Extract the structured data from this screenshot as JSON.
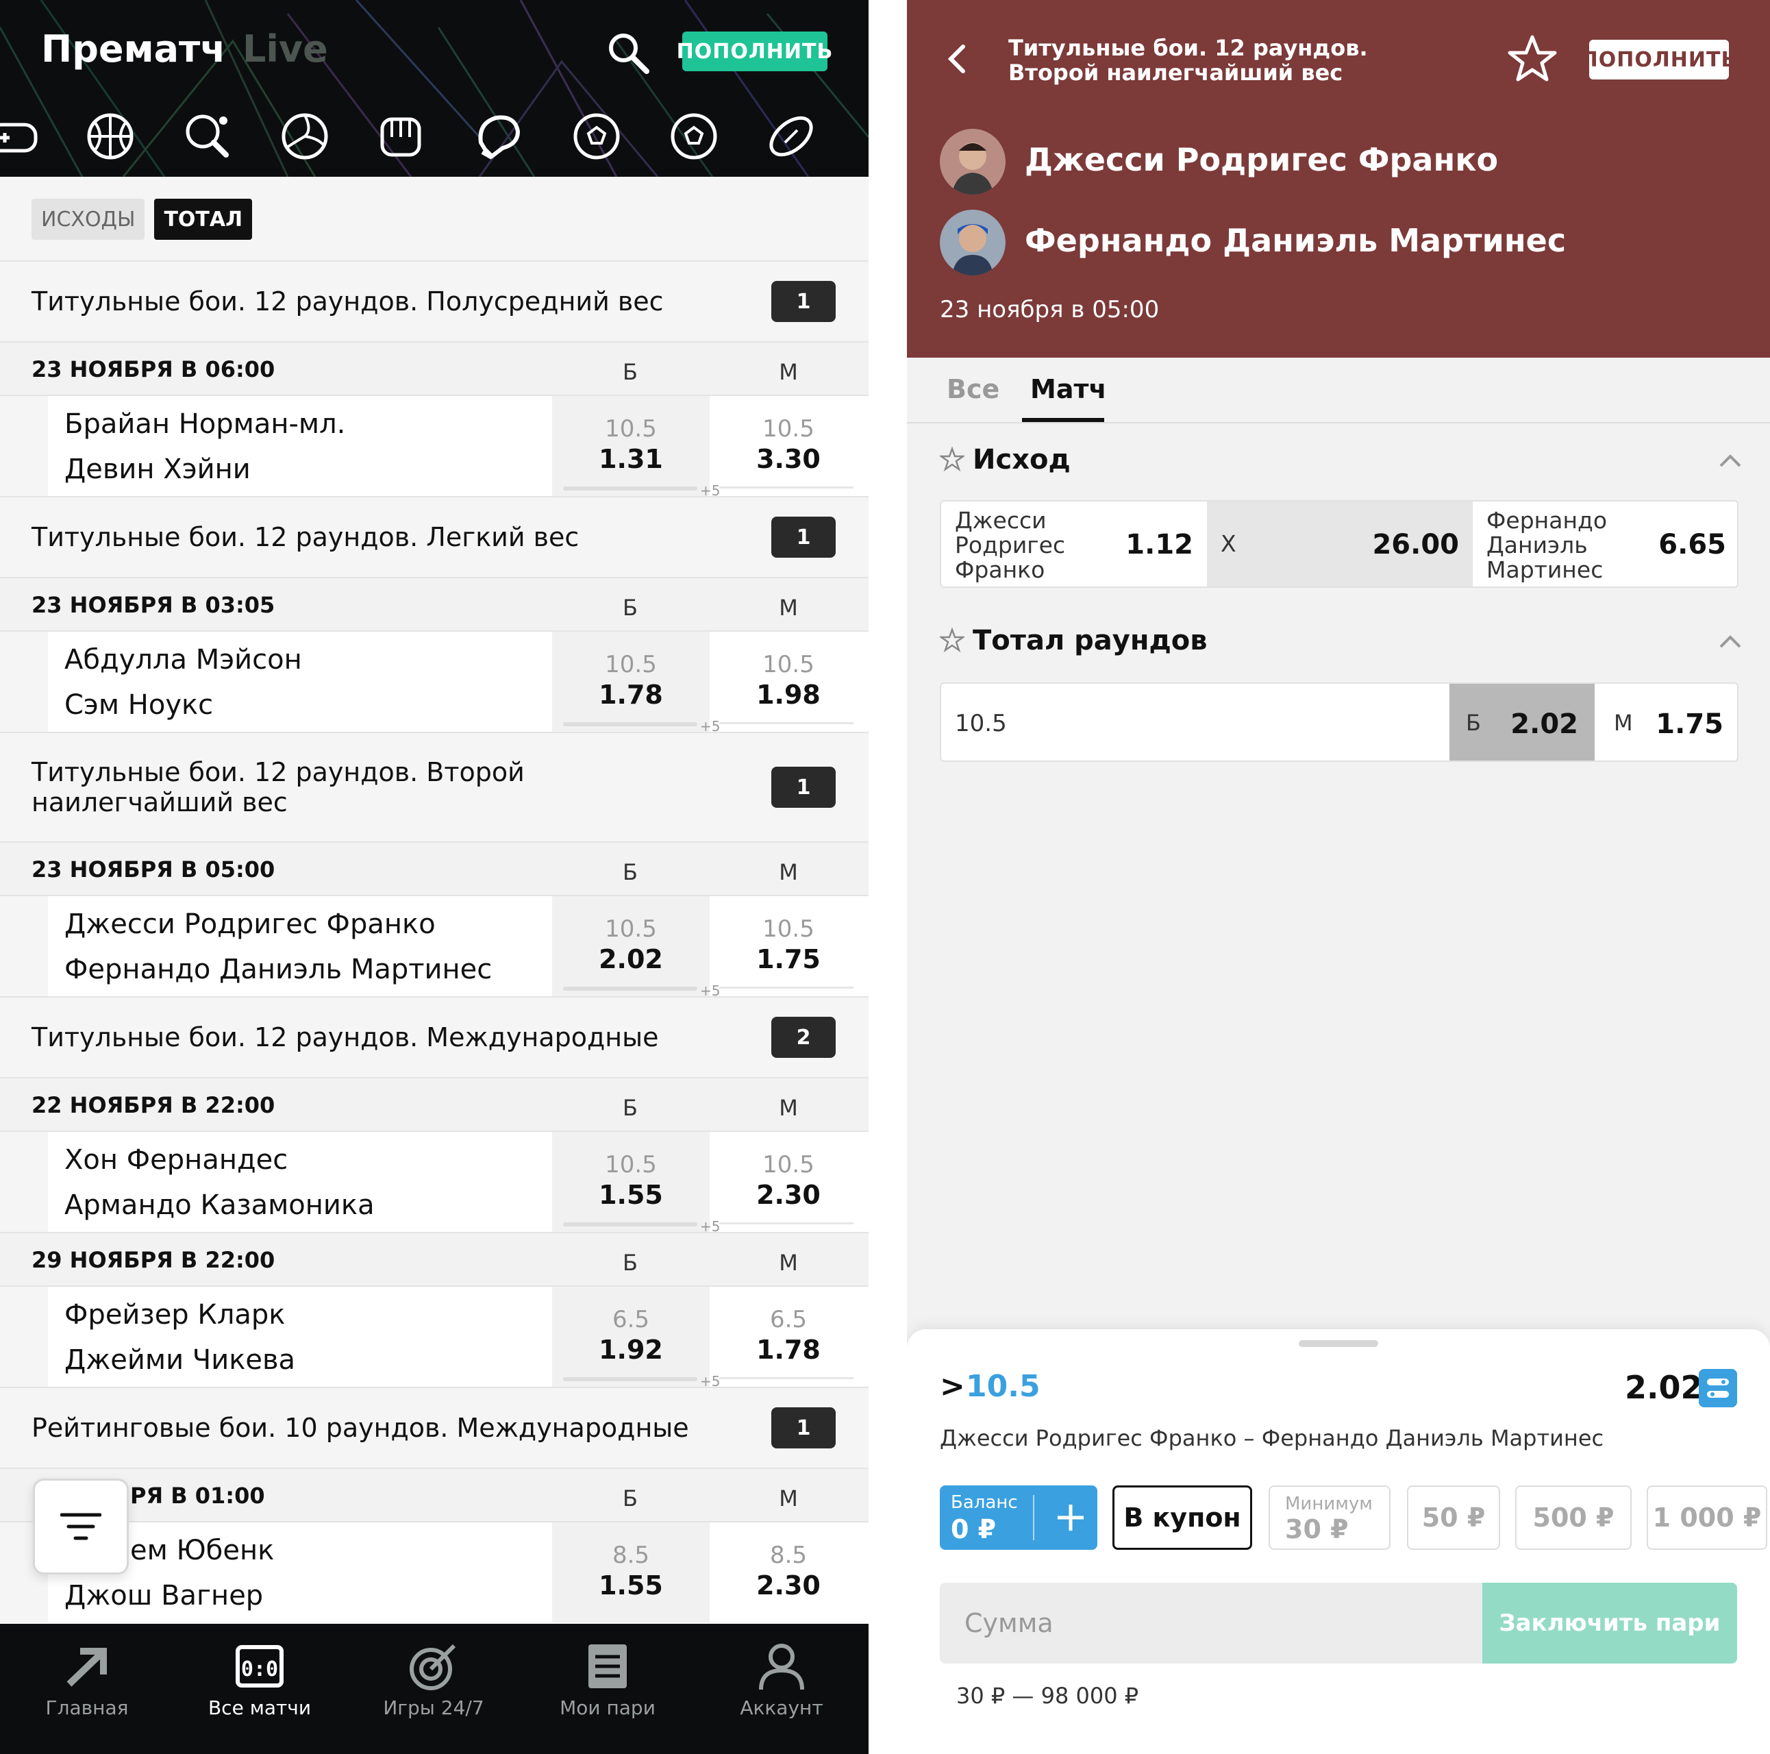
{
  "left": {
    "header": {
      "title_prematch": "Прематч",
      "title_live": "Live",
      "topup_label": "ПОПОЛНИТЬ"
    },
    "sports": [
      "gamepad-icon",
      "basketball-icon",
      "table-tennis-icon",
      "volleyball-icon",
      "mma-glove-icon",
      "boxing-glove-icon",
      "football-icon",
      "football-icon",
      "american-football-icon"
    ],
    "filters": {
      "outcomes": "ИСХОДЫ",
      "total": "ТОТАЛ"
    },
    "groups": [
      {
        "title": "Титульные бои. 12 раундов. Полусредний вес",
        "count": "1"
      },
      {
        "title": "Титульные бои. 12 раундов. Легкий вес",
        "count": "1"
      },
      {
        "title": "Титульные бои. 12 раундов. Второй наилегчайший вес",
        "count": "1"
      },
      {
        "title": "Титульные бои. 12 раундов. Международные",
        "count": "2"
      },
      {
        "title": "Рейтинговые бои. 10 раундов. Международные",
        "count": "1"
      }
    ],
    "col_b": "Б",
    "col_m": "М",
    "plus": "+5",
    "matches": [
      {
        "date": "23 НОЯБРЯ В 06:00",
        "p1": "Брайан Норман-мл.",
        "p2": "Девин Хэйни",
        "b_line": "10.5",
        "b_odd": "1.31",
        "m_line": "10.5",
        "m_odd": "3.30"
      },
      {
        "date": "23 НОЯБРЯ В 03:05",
        "p1": "Абдулла Мэйсон",
        "p2": "Сэм Ноукс",
        "b_line": "10.5",
        "b_odd": "1.78",
        "m_line": "10.5",
        "m_odd": "1.98"
      },
      {
        "date": "23 НОЯБРЯ В 05:00",
        "p1": "Джесси Родригес Франко",
        "p2": "Фернандо Даниэль Мартинес",
        "b_line": "10.5",
        "b_odd": "2.02",
        "m_line": "10.5",
        "m_odd": "1.75"
      },
      {
        "date": "22 НОЯБРЯ В 22:00",
        "p1": "Хон Фернандес",
        "p2": "Армандо Казамоника",
        "b_line": "10.5",
        "b_odd": "1.55",
        "m_line": "10.5",
        "m_odd": "2.30"
      },
      {
        "date": "29 НОЯБРЯ В 22:00",
        "p1": "Фрейзер Кларк",
        "p2": "Джейми Чикева",
        "b_line": "6.5",
        "b_odd": "1.92",
        "m_line": "6.5",
        "m_odd": "1.78"
      },
      {
        "date": "РЯ В 01:00",
        "p1": "ем Юбенк",
        "p2": "Джош Вагнер",
        "b_line": "8.5",
        "b_odd": "1.55",
        "m_line": "8.5",
        "m_odd": "2.30"
      }
    ],
    "tabbar": [
      {
        "label": "Главная",
        "icon": "arrow-icon"
      },
      {
        "label": "Все матчи",
        "icon": "scoreboard-icon"
      },
      {
        "label": "Игры 24/7",
        "icon": "target-icon"
      },
      {
        "label": "Мои пари",
        "icon": "receipt-icon"
      },
      {
        "label": "Аккаунт",
        "icon": "user-icon"
      }
    ]
  },
  "right": {
    "header": {
      "title": "Титульные бои. 12 раундов. Второй наилегчайший вес",
      "topup_label": "ПОПОЛНИТЬ",
      "fighter1": "Джесси Родригес Франко",
      "fighter2": "Фернандо Даниэль Мартинес",
      "date": "23 ноября в 05:00"
    },
    "tabs": {
      "all": "Все",
      "match": "Матч"
    },
    "outcome": {
      "title": "Исход",
      "p1_name": "Джесси Родригес Франко",
      "p1_odd": "1.12",
      "draw_name": "Х",
      "draw_odd": "26.00",
      "p2_name": "Фернандо Даниэль Мартинес",
      "p2_odd": "6.65"
    },
    "total": {
      "title": "Тотал раундов",
      "line": "10.5",
      "b_label": "Б",
      "b_odd": "2.02",
      "m_label": "М",
      "m_odd": "1.75"
    },
    "slip": {
      "gt": ">",
      "value": "10.5",
      "odd": "2.02",
      "match": "Джесси Родригес Франко – Фернандо Даниэль Мартинес",
      "balance_label": "Баланс",
      "balance_value": "0 ₽",
      "coupon_label": "В купон",
      "min_label": "Минимум",
      "min_value": "30 ₽",
      "amounts": [
        "50 ₽",
        "500 ₽",
        "1 000 ₽"
      ],
      "sum_placeholder": "Сумма",
      "place_label": "Заключить пари",
      "range": "30 ₽ — 98 000 ₽"
    }
  },
  "colors": {
    "accent_green": "#1ec495",
    "header_maroon": "#7c3a39",
    "link_blue": "#3aa0e0",
    "place_green": "#94dbc6"
  }
}
